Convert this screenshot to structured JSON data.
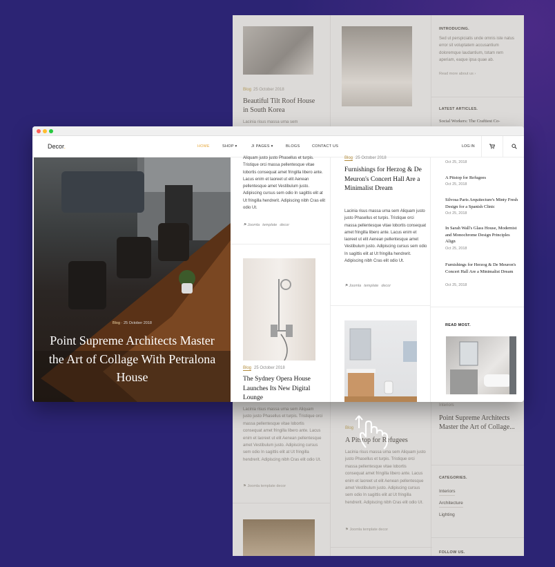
{
  "back_page": {
    "col1": {
      "post1": {
        "category": "Blog",
        "date": "25 October 2018",
        "title": "Beautiful Tilt Roof House in South Korea",
        "excerpt_start": "Lacinia risus massa urna sem"
      },
      "post2": {
        "excerpt": "Lacinia risus massa urna sem Aliquam justo justo Phasellus et turpis. Tristique orci massa pellentesque vitae lobortis consequat amet fringilla libero ante. Lacus enim et laoreet ut elit Aenean pellentesque amet Vestibulum justo. Adipiscing cursus sem odio In sagittis elit at Ut fringilla hendrerit. Adipiscing nibh Cras elit odio Ut.",
        "tags": [
          "Joomla",
          "template",
          "decor"
        ]
      }
    },
    "col2": {
      "post": {
        "category": "Blog",
        "title": "A Pitstop for Refugees",
        "excerpt": "Lacinia risus massa urna sem Aliquam justo justo Phasellus et turpis. Tristique orci massa pellentesque vitae lobortis consequat amet fringilla libero ante. Lacus enim et laoreet ut elit Aenean pellentesque amet Vestibulum justo. Adipiscing cursus sem odio In sagittis elit at Ut fringilla hendrerit. Adipiscing nibh Cras elit odio Ut.",
        "tags": [
          "Joomla",
          "template",
          "decor"
        ]
      }
    },
    "col3": {
      "intro_heading": "INTRODUCING.",
      "intro_text": "Sed ut perspiciatis unde omnis iste natus error sit voluptatem accusantium doloremque laudantium, totam rem aperiam, eaque ipsa quae ab.",
      "read_more": "Read more about us",
      "latest_heading": "LATEST ARTICLES.",
      "latest_first": "Social Workers: The Craftiest Co-",
      "read_most_category": "Interiors",
      "read_most_title": "Point Supreme Architects Master the Art of Collage...",
      "categories_heading": "CATEGORIES.",
      "categories": [
        "Interiors",
        "Architecture",
        "Lighting"
      ],
      "follow_heading": "FOLLOW US."
    }
  },
  "window": {
    "logo": "Decor",
    "logo_dot": ".",
    "nav": [
      {
        "label": "HOME",
        "active": true
      },
      {
        "label": "SHOP",
        "dropdown": true
      },
      {
        "label": "JI PAGES",
        "dropdown": true
      },
      {
        "label": "BLOGS"
      },
      {
        "label": "CONTACT US"
      }
    ],
    "login": "LOG IN",
    "hero": {
      "category": "Blog",
      "date": "25 October 2018",
      "title": "Point Supreme Architects Master the Art of Collage With Petralona House"
    },
    "colA": {
      "top_excerpt": "Aliquam justo justo Phasellus et turpis. Tristique orci massa pellentesque vitae lobortis consequat amet fringilla libero ante. Lacus enim et laoreet ut elit Aenean pellentesque amet Vestibulum justo. Adipiscing cursus sem odio In sagittis elit at Ut fringilla hendrerit. Adipiscing nibh Cras elit odio Ut.",
      "top_tags": [
        "Joomla",
        "template",
        "decor"
      ],
      "post": {
        "category": "Blog",
        "date": "25 October 2018",
        "title": "The Sydney Opera House Launches Its New Digital Lounge"
      }
    },
    "colB": {
      "post": {
        "category": "Blog",
        "date": "25 October 2018",
        "title": "Furnishings for Herzog & De Meuron's Concert Hall Are a Minimalist Dream",
        "excerpt": "Lacinia risus massa urna sem Aliquam justo justo Phasellus et turpis. Tristique orci massa pellentesque vitae lobortis consequat amet fringilla libero ante. Lacus enim et laoreet ut elit Aenean pellentesque amet Vestibulum justo. Adipiscing cursus sem odio In sagittis elit at Ut fringilla hendrerit. Adipiscing nibh Cras elit odio Ut.",
        "tags": [
          "Joomla",
          "template",
          "decor"
        ]
      }
    },
    "sidebar": {
      "first_date": "Oct 25, 2018",
      "latest": [
        {
          "title": "A Pitstop for Refugees",
          "date": "Oct 25, 2018"
        },
        {
          "title": "Silvosa Paris Arquitecture's Minty Fresh Design for a Spanish Clinic",
          "date": "Oct 25, 2018"
        },
        {
          "title": "In Sarah Wall's Glass House, Modernist and Monochrome Design Principles Align",
          "date": "Oct 25, 2018"
        },
        {
          "title": "Furnishings for Herzog & De Meuron's Concert Hall Are a Minimalist Dream",
          "date": "Oct 25, 2018"
        }
      ],
      "read_most_heading": "READ MOST."
    }
  },
  "colors": {
    "accent": "#e6a73a",
    "background": "#2c2474",
    "back_page": "#dcdad8"
  },
  "icons": {
    "cart": "cart-icon",
    "search": "search-icon",
    "tag": "tag-icon",
    "hand": "hand-scroll-icon"
  }
}
